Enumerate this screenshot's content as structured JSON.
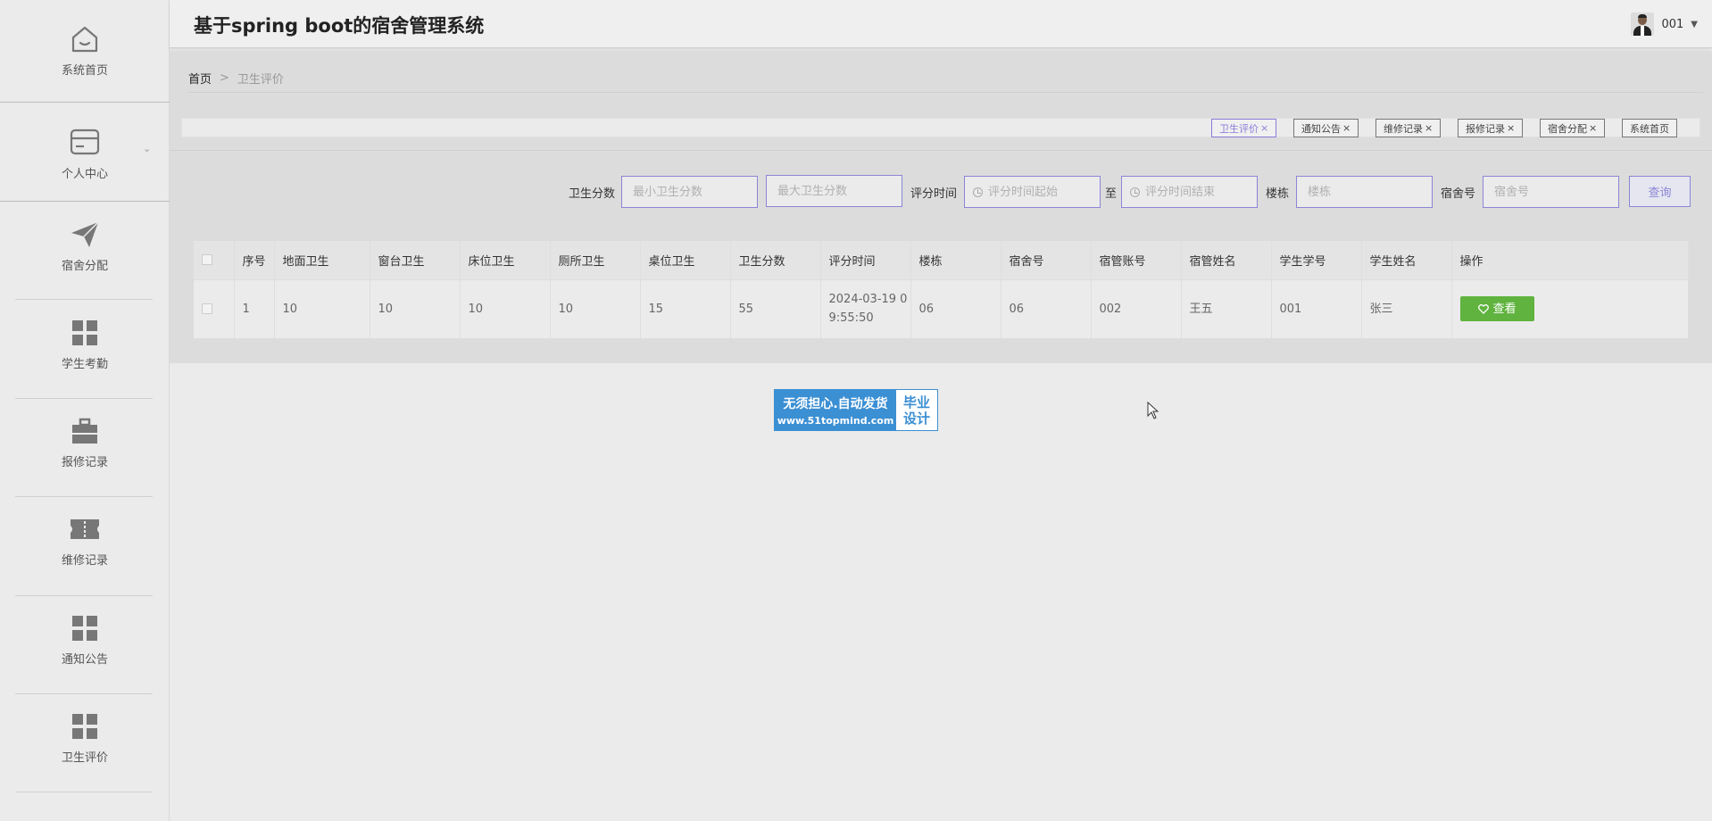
{
  "app": {
    "title": "基于spring boot的宿舍管理系统"
  },
  "user": {
    "name": "001",
    "dropdown_icon": "caret-down-icon"
  },
  "sidebar": {
    "items": [
      {
        "label": "系统首页",
        "icon": "home-icon"
      },
      {
        "label": "个人中心",
        "icon": "wallet-icon"
      },
      {
        "label": "宿舍分配",
        "icon": "send-icon"
      },
      {
        "label": "学生考勤",
        "icon": "grid-icon"
      },
      {
        "label": "报修记录",
        "icon": "briefcase-icon"
      },
      {
        "label": "维修记录",
        "icon": "ticket-icon"
      },
      {
        "label": "通知公告",
        "icon": "grid-icon"
      },
      {
        "label": "卫生评价",
        "icon": "grid-icon"
      }
    ]
  },
  "breadcrumb": {
    "home": "首页",
    "separator": ">",
    "current": "卫生评价"
  },
  "tags": [
    {
      "label": "卫生评价",
      "close": "×",
      "active": true
    },
    {
      "label": "通知公告",
      "close": "×"
    },
    {
      "label": "维修记录",
      "close": "×"
    },
    {
      "label": "报修记录",
      "close": "×"
    },
    {
      "label": "宿舍分配",
      "close": "×"
    },
    {
      "label": "系统首页",
      "close": ""
    }
  ],
  "search": {
    "score_label": "卫生分数",
    "min_score_placeholder": "最小卫生分数",
    "max_score_placeholder": "最大卫生分数",
    "time_label": "评分时间",
    "time_start_placeholder": "评分时间起始",
    "time_to": "至",
    "time_end_placeholder": "评分时间结束",
    "building_label": "楼栋",
    "building_placeholder": "楼栋",
    "room_label": "宿舍号",
    "room_placeholder": "宿舍号",
    "query_button": "查询"
  },
  "table": {
    "headers": [
      "序号",
      "地面卫生",
      "窗台卫生",
      "床位卫生",
      "厕所卫生",
      "桌位卫生",
      "卫生分数",
      "评分时间",
      "楼栋",
      "宿舍号",
      "宿管账号",
      "宿管姓名",
      "学生学号",
      "学生姓名",
      "操作"
    ],
    "rows": [
      {
        "index": "1",
        "floor": "10",
        "window": "10",
        "bed": "10",
        "toilet": "10",
        "desk": "15",
        "score": "55",
        "time": "2024-03-19 09:55:50",
        "time_line1": "2024-03-19 0",
        "time_line2": "9:55:50",
        "building": "06",
        "room": "06",
        "manager_account": "002",
        "manager_name": "王五",
        "student_id": "001",
        "student_name": "张三",
        "action": "查看"
      }
    ]
  },
  "ad": {
    "line1": "无须担心.自动发货",
    "line2": "www.51topmind.com",
    "tag1": "毕业",
    "tag2": "设计",
    "color": "#3b8fd3"
  },
  "colors": {
    "accent": "#8c85d6",
    "view_button": "#5fb33e"
  }
}
